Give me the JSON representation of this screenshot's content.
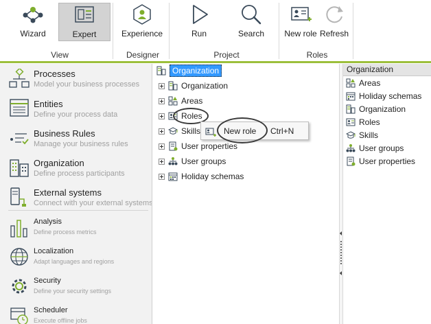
{
  "ribbon": {
    "buttons": [
      {
        "label": "Wizard",
        "icon": "wizard-icon"
      },
      {
        "label": "Expert",
        "icon": "expert-icon",
        "active": true
      },
      {
        "label": "Experience",
        "icon": "experience-icon"
      },
      {
        "label": "Run",
        "icon": "run-icon"
      },
      {
        "label": "Search",
        "icon": "search-icon"
      },
      {
        "label": "New role",
        "icon": "new-role-icon"
      },
      {
        "label": "Refresh",
        "icon": "refresh-icon"
      }
    ],
    "groups": [
      "View",
      "Designer",
      "Project",
      "Roles"
    ],
    "accent_color": "#9cbf3b"
  },
  "leftnav": {
    "items": [
      {
        "title": "Processes",
        "desc": "Model your business processes",
        "icon": "processes-icon"
      },
      {
        "title": "Entities",
        "desc": "Define your process data",
        "icon": "entities-icon"
      },
      {
        "title": "Business Rules",
        "desc": "Manage your business rules",
        "icon": "business-rules-icon"
      },
      {
        "title": "Organization",
        "desc": "Define process participants",
        "icon": "organization-icon"
      },
      {
        "title": "External systems",
        "desc": "Connect with your external systems",
        "icon": "external-systems-icon"
      },
      {
        "title": "Analysis",
        "desc": "Define process metrics",
        "icon": "analysis-icon"
      },
      {
        "title": "Localization",
        "desc": "Adapt languages and regions",
        "icon": "localization-icon"
      },
      {
        "title": "Security",
        "desc": "Define your security settings",
        "icon": "security-icon"
      },
      {
        "title": "Scheduler",
        "desc": "Execute offline jobs",
        "icon": "scheduler-icon"
      }
    ]
  },
  "tree": {
    "root": "Organization",
    "children": [
      "Organization",
      "Areas",
      "Roles",
      "Skills",
      "User properties",
      "User groups",
      "Holiday schemas"
    ]
  },
  "context_menu": {
    "item": "New role",
    "shortcut": "Ctrl+N"
  },
  "right_panel": {
    "header": "Organization",
    "items": [
      "Areas",
      "Holiday schemas",
      "Organization",
      "Roles",
      "Skills",
      "User groups",
      "User properties"
    ]
  },
  "colors": {
    "selection": "#3399ff",
    "icon_green": "#7fae2d",
    "icon_dark": "#3a4a5a"
  }
}
